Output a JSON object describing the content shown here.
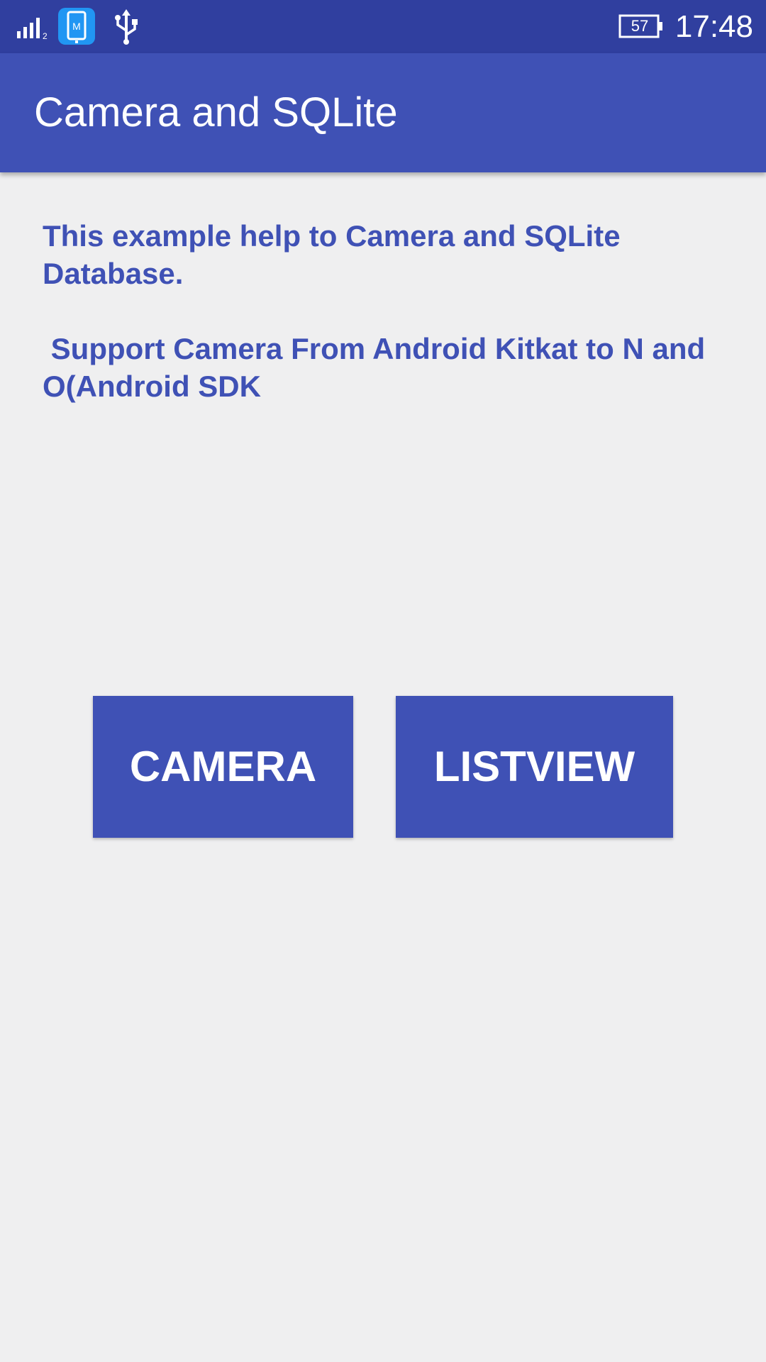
{
  "status_bar": {
    "signal_icon": "signal-icon",
    "signal_sim": "2",
    "notification_icon": "phone-app-icon",
    "notification_letter": "M",
    "usb_icon": "usb-icon",
    "battery_level": "57",
    "time": "17:48"
  },
  "app_bar": {
    "title": "Camera and SQLite"
  },
  "main": {
    "description_line1": "This example help to Camera and SQLite Database.",
    "description_line2": " Support Camera From Android Kitkat to N and O(Android SDK"
  },
  "buttons": {
    "camera_label": "CAMERA",
    "listview_label": "LISTVIEW"
  },
  "colors": {
    "status_bar": "#303f9f",
    "primary": "#3f51b5",
    "background": "#efeff0",
    "notification_blue": "#2196f3"
  }
}
